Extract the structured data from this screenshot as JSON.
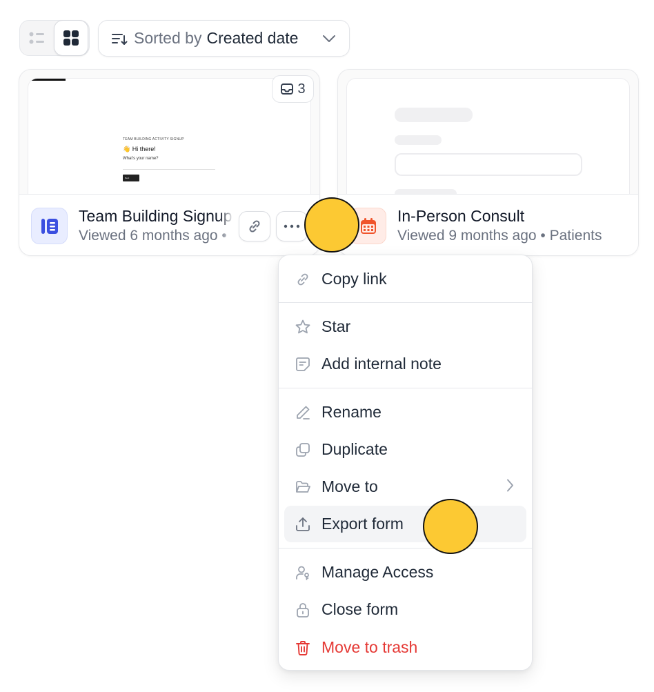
{
  "toolbar": {
    "view_list_icon": "list-view-icon",
    "view_grid_icon": "grid-view-icon",
    "sort_icon": "sort-icon",
    "sort_label": "Sorted by",
    "sort_value": "Created date"
  },
  "cards": [
    {
      "title": "Team Building Signup",
      "subtitle": "Viewed 6 months ago •",
      "responses_count": "3",
      "icon": "form-icon",
      "preview": {
        "heading": "TEAM BUILDING ACTIVITY SIGNUP",
        "greeting": "👋 Hi there!",
        "question": "What's your name?",
        "button": "Next"
      }
    },
    {
      "title": "In-Person Consult",
      "subtitle": "Viewed 9 months ago • Patients",
      "icon": "calendar-icon"
    }
  ],
  "menu": {
    "items": [
      {
        "label": "Copy link",
        "icon": "link-icon"
      },
      {
        "label": "Star",
        "icon": "star-icon"
      },
      {
        "label": "Add internal note",
        "icon": "note-icon"
      },
      {
        "label": "Rename",
        "icon": "pencil-icon"
      },
      {
        "label": "Duplicate",
        "icon": "duplicate-icon"
      },
      {
        "label": "Move to",
        "icon": "folder-icon"
      },
      {
        "label": "Export form",
        "icon": "export-icon"
      },
      {
        "label": "Manage Access",
        "icon": "user-key-icon"
      },
      {
        "label": "Close form",
        "icon": "lock-icon"
      },
      {
        "label": "Move to trash",
        "icon": "trash-icon"
      }
    ]
  },
  "colors": {
    "accent_blue": "#3b4fe0",
    "calendar_red": "#f0542c",
    "danger": "#e53935",
    "marker": "#fcc933"
  }
}
